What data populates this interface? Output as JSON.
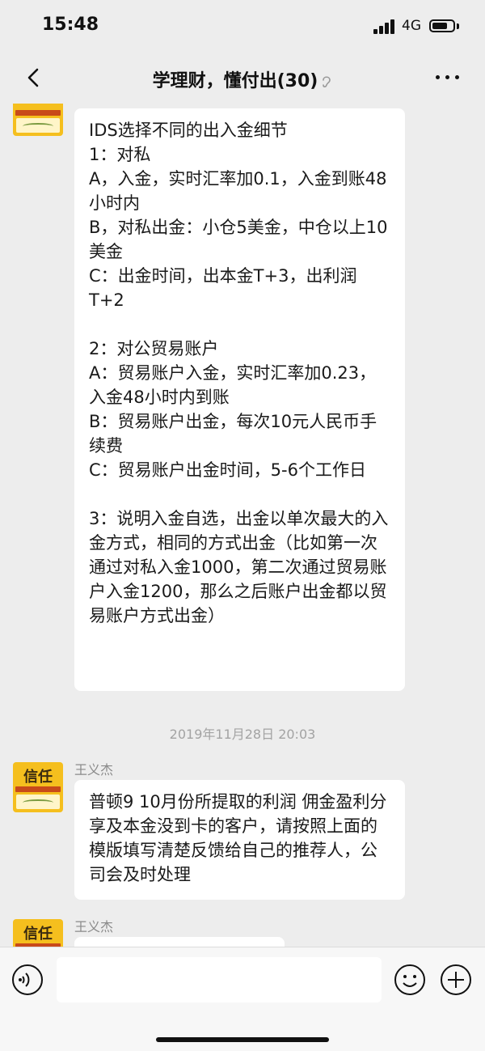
{
  "status_bar": {
    "time": "15:48",
    "network": "4G",
    "battery_level": 0.75
  },
  "header": {
    "title": "学理财，懂付出(30)",
    "back_icon": "chevron-left-icon",
    "ear_icon": "ear-icon",
    "more_icon": "more-dots-icon"
  },
  "chat": {
    "messages": [
      {
        "avatar_text": "",
        "text": "IDS选择不同的出入金细节\n1：对私\nA，入金，实时汇率加0.1，入金到账48小时内\nB，对私出金：小仓5美金，中仓以上10美金\nC：出金时间，出本金T+3，出利润T+2\n\n2：对公贸易账户\nA：贸易账户入金，实时汇率加0.23，入金48小时内到账\nB：贸易账户出金，每次10元人民币手续费\nC：贸易账户出金时间，5-6个工作日\n\n3：说明入金自选，出金以单次最大的入金方式，相同的方式出金（比如第一次通过对私入金1000，第二次通过贸易账户入金1200，那么之后账户出金都以贸易账户方式出金）"
      },
      {
        "timestamp": "2019年11月28日 20:03",
        "sender": "王义杰",
        "avatar_text": "信任",
        "text": "普顿9 10月份所提取的利润 佣金盈利分享及本金没到卡的客户，请按照上面的模版填写清楚反馈给自己的推荐人，公司会及时处理"
      },
      {
        "sender": "王义杰",
        "avatar_text": "信任",
        "text": ""
      }
    ]
  },
  "input_bar": {
    "placeholder": "",
    "voice_icon": "voice-icon",
    "emoji_icon": "emoji-icon",
    "add_icon": "plus-circle-icon"
  }
}
